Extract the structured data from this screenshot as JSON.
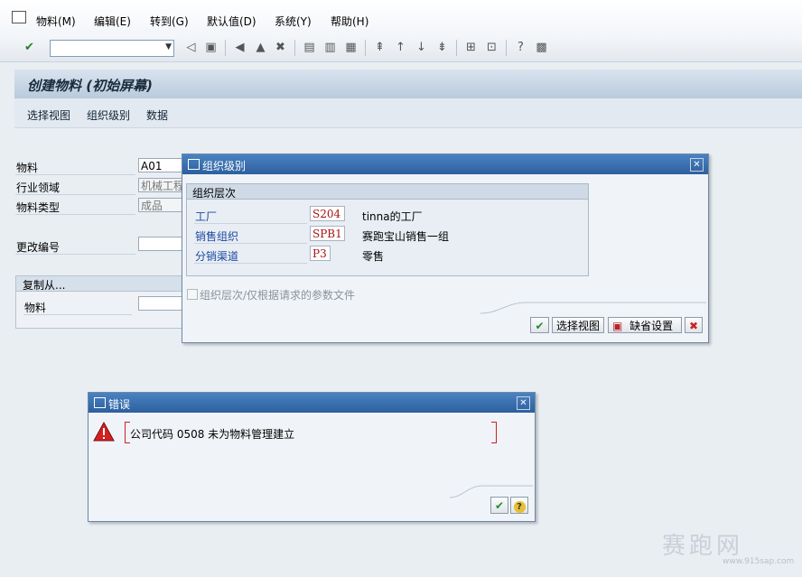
{
  "menu": [
    "物料(M)",
    "编辑(E)",
    "转到(G)",
    "默认值(D)",
    "系统(Y)",
    "帮助(H)"
  ],
  "command_field": {
    "value": ""
  },
  "page_title": "创建物料 (初始屏幕)",
  "app_toolbar": [
    "选择视图",
    "组织级别",
    "数据"
  ],
  "form": {
    "material_label": "物料",
    "material_value": "A01",
    "industry_label": "行业领域",
    "industry_value": "机械工程",
    "type_label": "物料类型",
    "type_value": "成品",
    "change_label": "更改编号",
    "change_value": "",
    "copy_from_title": "复制从...",
    "copy_material_label": "物料",
    "copy_material_value": ""
  },
  "org_dialog": {
    "title": "组织级别",
    "group_title": "组织层次",
    "rows": [
      {
        "label": "工厂",
        "value": "S204",
        "desc": "tinna的工厂"
      },
      {
        "label": "销售组织",
        "value": "SPB1",
        "desc": "赛跑宝山销售一组"
      },
      {
        "label": "分销渠道",
        "value": "P3",
        "desc": "零售"
      }
    ],
    "checkbox_label": "组织层次/仅根据请求的参数文件",
    "btn_select_views": "选择视图",
    "btn_defaults": "缺省设置"
  },
  "error_dialog": {
    "title": "错误",
    "message": "公司代码 0508 未为物料管理建立"
  },
  "watermark": {
    "text": "赛跑网",
    "url": "www.915sap.com"
  },
  "colors": {
    "title_bar": "#2d5f9e",
    "accent_label": "#1d48a0",
    "error_value": "#a11111"
  }
}
